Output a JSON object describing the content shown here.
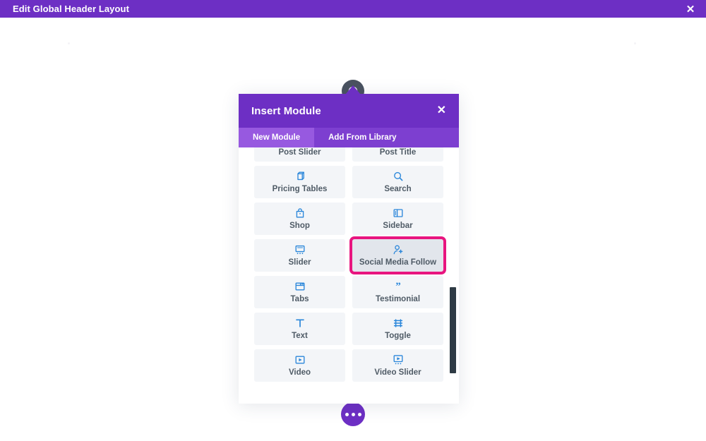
{
  "topbar": {
    "title": "Edit Global Header Layout",
    "close_label": "✕",
    "close_icon": "close-icon"
  },
  "section_handle": {
    "icon": "clock-icon"
  },
  "modal": {
    "title": "Insert Module",
    "close_label": "✕",
    "close_icon": "close-icon",
    "tabs": [
      {
        "label": "New Module",
        "active": true
      },
      {
        "label": "Add From Library",
        "active": false
      }
    ],
    "modules": [
      {
        "label": "Post Slider",
        "icon": "post-slider-icon",
        "highlighted": false
      },
      {
        "label": "Post Title",
        "icon": "post-title-icon",
        "highlighted": false
      },
      {
        "label": "Pricing Tables",
        "icon": "pricing-tables-icon",
        "highlighted": false
      },
      {
        "label": "Search",
        "icon": "search-icon",
        "highlighted": false
      },
      {
        "label": "Shop",
        "icon": "shop-bag-icon",
        "highlighted": false
      },
      {
        "label": "Sidebar",
        "icon": "sidebar-icon",
        "highlighted": false
      },
      {
        "label": "Slider",
        "icon": "slider-icon",
        "highlighted": false
      },
      {
        "label": "Social Media Follow",
        "icon": "social-media-follow-icon",
        "highlighted": true
      },
      {
        "label": "Tabs",
        "icon": "tabs-icon",
        "highlighted": false
      },
      {
        "label": "Testimonial",
        "icon": "quote-icon",
        "highlighted": false
      },
      {
        "label": "Text",
        "icon": "text-icon",
        "highlighted": false
      },
      {
        "label": "Toggle",
        "icon": "toggle-icon",
        "highlighted": false
      },
      {
        "label": "Video",
        "icon": "video-icon",
        "highlighted": false
      },
      {
        "label": "Video Slider",
        "icon": "video-slider-icon",
        "highlighted": false
      }
    ]
  },
  "add_button": {
    "icon": "ellipsis-icon"
  },
  "colors": {
    "brand_purple": "#6d2fc4",
    "tab_bar_purple": "#7d3fd0",
    "tab_active_purple": "#9759e0",
    "highlight_pink": "#e8157f",
    "module_icon_blue": "#2b87da",
    "module_cell_bg": "#f3f5f8",
    "module_cell_bg_selected": "#e2e6ec",
    "scrollbar": "#2f3b45",
    "handle_grey": "#4a5260",
    "label_text": "#4f5b66"
  }
}
